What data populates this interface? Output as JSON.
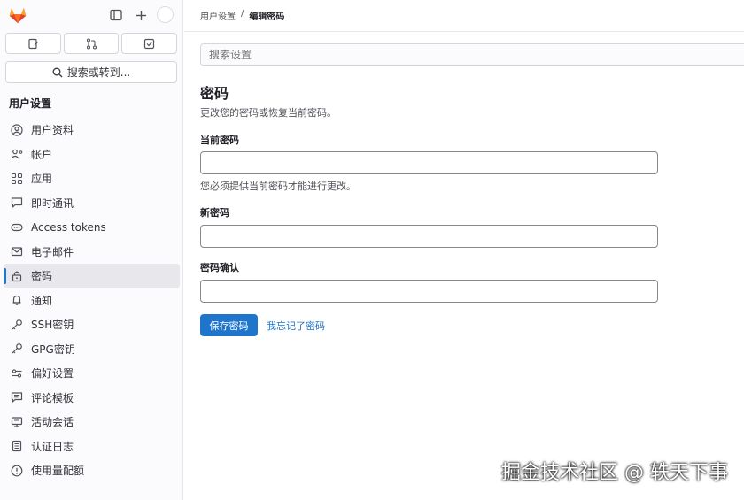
{
  "sidebar": {
    "title": "用户设置",
    "search_label": "搜索或转到...",
    "items": [
      {
        "label": "用户资料",
        "icon": "user-circle-icon",
        "active": false
      },
      {
        "label": "帐户",
        "icon": "user-gear-icon",
        "active": false
      },
      {
        "label": "应用",
        "icon": "apps-grid-icon",
        "active": false
      },
      {
        "label": "即时通讯",
        "icon": "chat-bubble-icon",
        "active": false
      },
      {
        "label": "Access tokens",
        "icon": "token-icon",
        "active": false
      },
      {
        "label": "电子邮件",
        "icon": "envelope-icon",
        "active": false
      },
      {
        "label": "密码",
        "icon": "lock-icon",
        "active": true
      },
      {
        "label": "通知",
        "icon": "bell-icon",
        "active": false
      },
      {
        "label": "SSH密钥",
        "icon": "key-icon",
        "active": false
      },
      {
        "label": "GPG密钥",
        "icon": "key-icon",
        "active": false
      },
      {
        "label": "偏好设置",
        "icon": "preferences-icon",
        "active": false
      },
      {
        "label": "评论模板",
        "icon": "comment-template-icon",
        "active": false
      },
      {
        "label": "活动会话",
        "icon": "monitor-icon",
        "active": false
      },
      {
        "label": "认证日志",
        "icon": "log-icon",
        "active": false
      },
      {
        "label": "使用量配额",
        "icon": "quota-icon",
        "active": false
      }
    ]
  },
  "breadcrumb": {
    "parent": "用户设置",
    "separator": "/",
    "current": "编辑密码"
  },
  "search": {
    "placeholder": "搜索设置"
  },
  "form": {
    "title": "密码",
    "description": "更改您的密码或恢复当前密码。",
    "current_label": "当前密码",
    "current_help": "您必须提供当前密码才能进行更改。",
    "new_label": "新密码",
    "confirm_label": "密码确认",
    "save_label": "保存密码",
    "forgot_label": "我忘记了密码"
  },
  "watermark": "掘金技术社区 @ 轶天下事",
  "colors": {
    "accent": "#1f75cb",
    "logo_orange": "#e24329"
  }
}
